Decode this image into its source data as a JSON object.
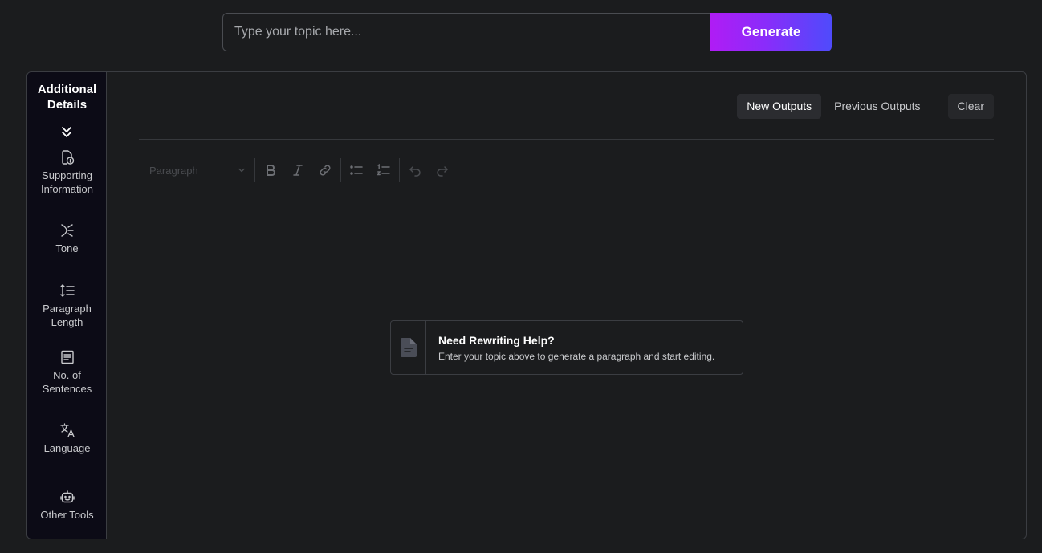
{
  "search": {
    "placeholder": "Type your topic here...",
    "value": "",
    "generate_label": "Generate"
  },
  "sidebar": {
    "title_line1": "Additional",
    "title_line2": "Details",
    "items": [
      {
        "label": "Supporting Information",
        "icon": "document-info-icon"
      },
      {
        "label": "Tone",
        "icon": "tone-icon"
      },
      {
        "label": "Paragraph Length",
        "icon": "line-height-icon"
      },
      {
        "label": "No. of Sentences",
        "icon": "sentences-icon"
      },
      {
        "label": "Language",
        "icon": "translate-icon"
      },
      {
        "label": "Other Tools",
        "icon": "robot-icon"
      }
    ]
  },
  "tabs": {
    "new_outputs": "New Outputs",
    "previous_outputs": "Previous Outputs",
    "clear": "Clear"
  },
  "editor": {
    "block_type": "Paragraph"
  },
  "empty_state": {
    "title": "Need Rewriting Help?",
    "description": "Enter your topic above to generate a paragraph and start editing."
  },
  "colors": {
    "background": "#1b1c1e",
    "sidebar": "#0c0b16",
    "generate_gradient_start": "#b01cf5",
    "generate_gradient_end": "#4f4bfb"
  }
}
